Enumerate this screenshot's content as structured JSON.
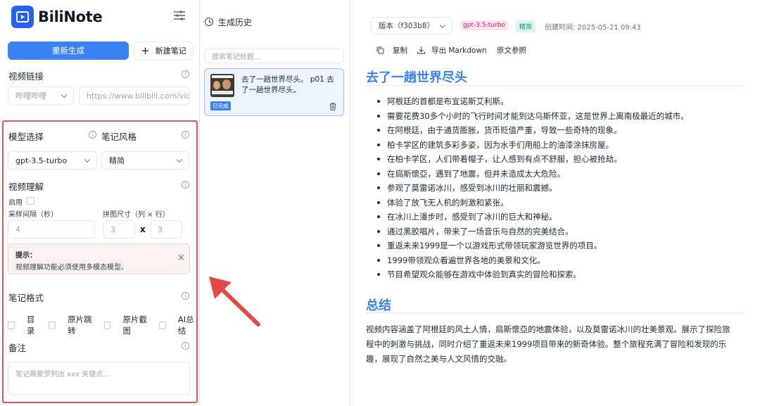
{
  "app": {
    "name": "BiliNote"
  },
  "sidebar": {
    "regen_button": "重新生成",
    "new_note_button": "新建笔记",
    "video_link": {
      "title": "视频链接",
      "platform": "哔哩哔哩",
      "url_placeholder": "https://www.bilibili.com/video/..."
    },
    "model": {
      "title": "模型选择",
      "selected": "gpt-3.5-turbo"
    },
    "style": {
      "title": "笔记风格",
      "selected": "精简"
    },
    "video_understanding": {
      "title": "视频理解",
      "enable_label": "启用",
      "interval_label": "采样间隔（秒）",
      "interval_value": "4",
      "grid_label": "拼图尺寸（列 × 行）",
      "grid_cols": "3",
      "grid_x": "x",
      "grid_rows": "3"
    },
    "alert": {
      "title": "提示：",
      "text": "视频理解功能必须使用多模态模型。",
      "close": "×"
    },
    "format": {
      "title": "笔记格式",
      "options": [
        "目录",
        "原片跳转",
        "原片截图",
        "AI总结"
      ]
    },
    "remark": {
      "title": "备注",
      "placeholder": "笔记需要罗列出 xxx 关键点..."
    }
  },
  "history": {
    "title": "生成历史",
    "search_placeholder": "搜索笔记标题...",
    "items": [
      {
        "title": "去了一趟世界尽头。 p01 去了一趟世界尽头。",
        "status": "已完成"
      }
    ]
  },
  "toolbar": {
    "version": "版本（f303b8）",
    "model_tag": "gpt-3.5-turbo",
    "style_tag": "精简",
    "created": "创建时间: 2025-05-21 09:43",
    "copy": "复制",
    "export": "导出 Markdown",
    "reference": "原文参照"
  },
  "note": {
    "heading1": "去了一趟世界尽头",
    "bullets": [
      "阿根廷的首都是布宜诺斯艾利斯。",
      "需要花费30多个小时的飞行时间才能到达乌斯怀亚，这是世界上离南极最近的城市。",
      "在阿根廷，由于通货膨胀，货币贬值严重，导致一些奇特的现象。",
      "柏卡学区的建筑多彩多姿，因为水手们用船上的油漆涂抹房屋。",
      "在柏卡学区，人们带着帽子，让人感到有点不舒服，担心被抢劫。",
      "在扃斯懷亞，遇到了地震，但并未造成太大危险。",
      "参观了莫雷诺冰川，感受到冰川的壮丽和震撼。",
      "体验了放飞无人机的刺激和紧张。",
      "在冰川上漫步时，感受到了冰川的巨大和神秘。",
      "通过黑胶唱片，带来了一场音乐与自然的完美结合。",
      "重返未来1999是一个以游戏形式带领玩家游览世界的项目。",
      "1999带领观众看遍世界各地的美景和文化。",
      "节目希望观众能够在游戏中体验到真实的冒险和探索。"
    ],
    "heading2": "总结",
    "summary_lines": [
      "视频内容涵盖了阿根廷的风土人情，扃斯懷亞的地震体验，以及莫雷诺冰川的壮美景观。展示了探险旅",
      "程中的刺激与挑战，同时介绍了重返未来1999项目带来的新奇体验。整个旅程充满了冒险和发现的乐",
      "趣，展现了自然之美与人文风情的交融。"
    ]
  },
  "colors": {
    "accent": "#3b82f6",
    "highlight_border": "#e55353",
    "arrow": "#e24a4a"
  }
}
